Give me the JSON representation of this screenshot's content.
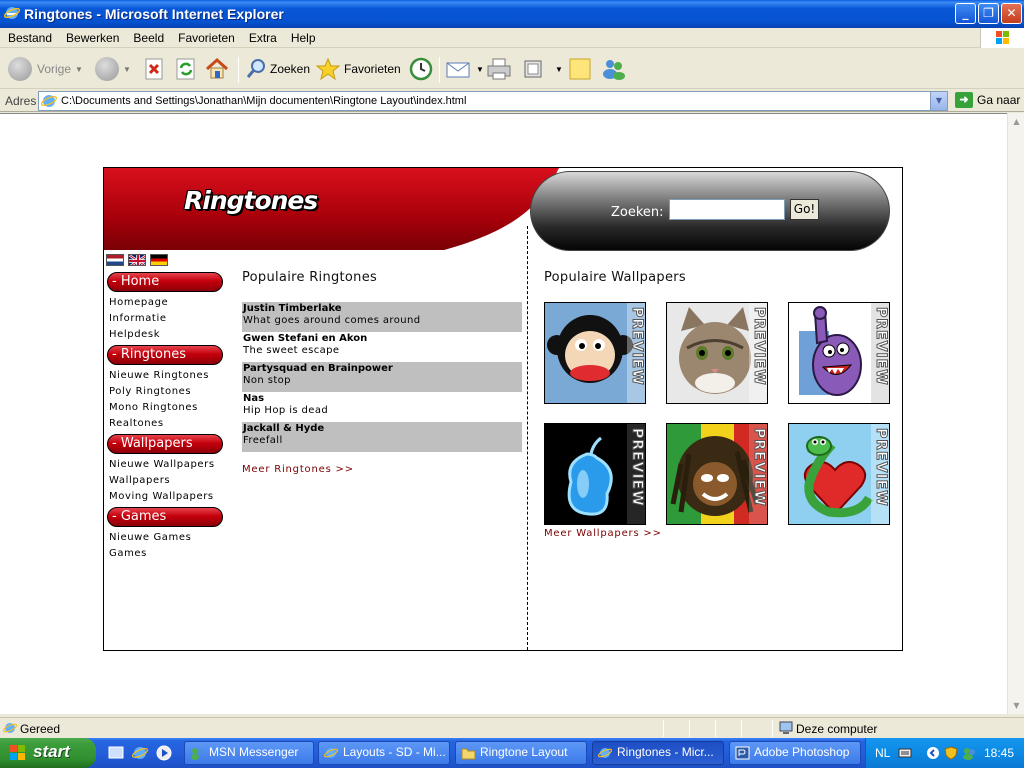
{
  "window": {
    "title": "Ringtones - Microsoft Internet Explorer",
    "minimize_icon": "minimize-icon",
    "maximize_icon": "maximize-icon",
    "close_icon": "close-icon"
  },
  "menu": [
    "Bestand",
    "Bewerken",
    "Beeld",
    "Favorieten",
    "Extra",
    "Help"
  ],
  "toolbar": {
    "back_label": "Vorige",
    "search_label": "Zoeken",
    "favorites_label": "Favorieten"
  },
  "address": {
    "label": "Adres",
    "url": "C:\\Documents and Settings\\Jonathan\\Mijn documenten\\Ringtone Layout\\index.html",
    "go_label": "Ga naar"
  },
  "site": {
    "logo": "Ringtones",
    "search_label": "Zoeken:",
    "search_value": "",
    "search_button": "Go!",
    "colors": {
      "accent": "#c4000c",
      "dark": "#000000",
      "row_shade": "#bfbfbf",
      "link_more": "#7a0000"
    },
    "sidebar": [
      {
        "heading": "- Home",
        "links": [
          "Homepage",
          "Informatie",
          "Helpdesk"
        ]
      },
      {
        "heading": "- Ringtones",
        "links": [
          "Nieuwe Ringtones",
          "Poly Ringtones",
          "Mono Ringtones",
          "Realtones"
        ]
      },
      {
        "heading": "- Wallpapers",
        "links": [
          "Nieuwe Wallpapers",
          "Wallpapers",
          "Moving Wallpapers"
        ]
      },
      {
        "heading": "- Games",
        "links": [
          "Nieuwe Games",
          "Games"
        ]
      }
    ],
    "ringtones_title": "Populaire Ringtones",
    "ringtones": [
      {
        "artist": "Justin Timberlake",
        "song": "What goes around comes around",
        "shaded": true
      },
      {
        "artist": "Gwen Stefani en Akon",
        "song": "The sweet escape",
        "shaded": false
      },
      {
        "artist": "Partysquad en Brainpower",
        "song": "Non stop",
        "shaded": true
      },
      {
        "artist": "Nas",
        "song": "Hip Hop is dead",
        "shaded": false
      },
      {
        "artist": "Jackall & Hyde",
        "song": "Freefall",
        "shaded": true
      }
    ],
    "ringtones_more": "Meer Ringtones >>",
    "wallpapers_title": "Populaire Wallpapers",
    "wallpapers": [
      {
        "name": "monkey-wallpaper",
        "badge": "PREVIEW"
      },
      {
        "name": "kitten-wallpaper",
        "badge": "PREVIEW"
      },
      {
        "name": "purple-monster-wallpaper",
        "badge": "PREVIEW"
      },
      {
        "name": "glowing-pear-wallpaper",
        "badge": "PREVIEW"
      },
      {
        "name": "rasta-face-wallpaper",
        "badge": "PREVIEW"
      },
      {
        "name": "snake-heart-wallpaper",
        "badge": "PREVIEW"
      }
    ],
    "wallpapers_more": "Meer Wallpapers >>"
  },
  "status": {
    "text": "Gereed",
    "zone": "Deze computer"
  },
  "taskbar": {
    "start": "start",
    "tasks": [
      {
        "label": "MSN Messenger",
        "active": false
      },
      {
        "label": "Layouts - SD - Mi...",
        "active": false
      },
      {
        "label": "Ringtone Layout",
        "active": false
      },
      {
        "label": "Ringtones - Micr...",
        "active": true
      },
      {
        "label": "Adobe Photoshop",
        "active": false
      }
    ],
    "language": "NL",
    "clock": "18:45"
  }
}
